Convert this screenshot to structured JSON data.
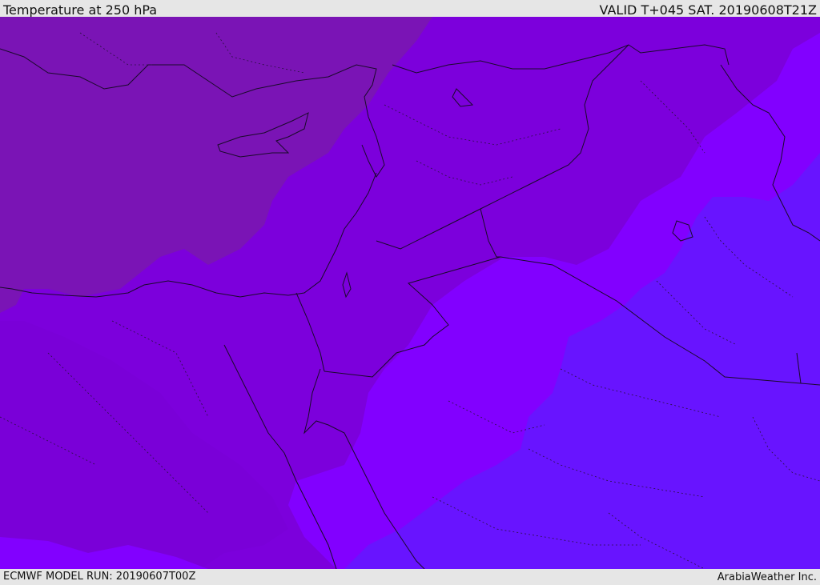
{
  "header": {
    "title": "Temperature at 250 hPa",
    "valid": "VALID T+045 SAT. 20190608T21Z"
  },
  "footer": {
    "model_run": "ECMWF MODEL RUN: 20190607T00Z",
    "brand": "ArabiaWeather Inc."
  },
  "map": {
    "field": "temperature",
    "level": "250 hPa",
    "colors": {
      "coldest_zone": "#7a14b5",
      "cold_zone": "#7c00dc",
      "mid_zone": "#8200ff",
      "warm_zone": "#6814ff",
      "coastline": "#1a0a2a",
      "border": "#1a0a2a"
    }
  }
}
